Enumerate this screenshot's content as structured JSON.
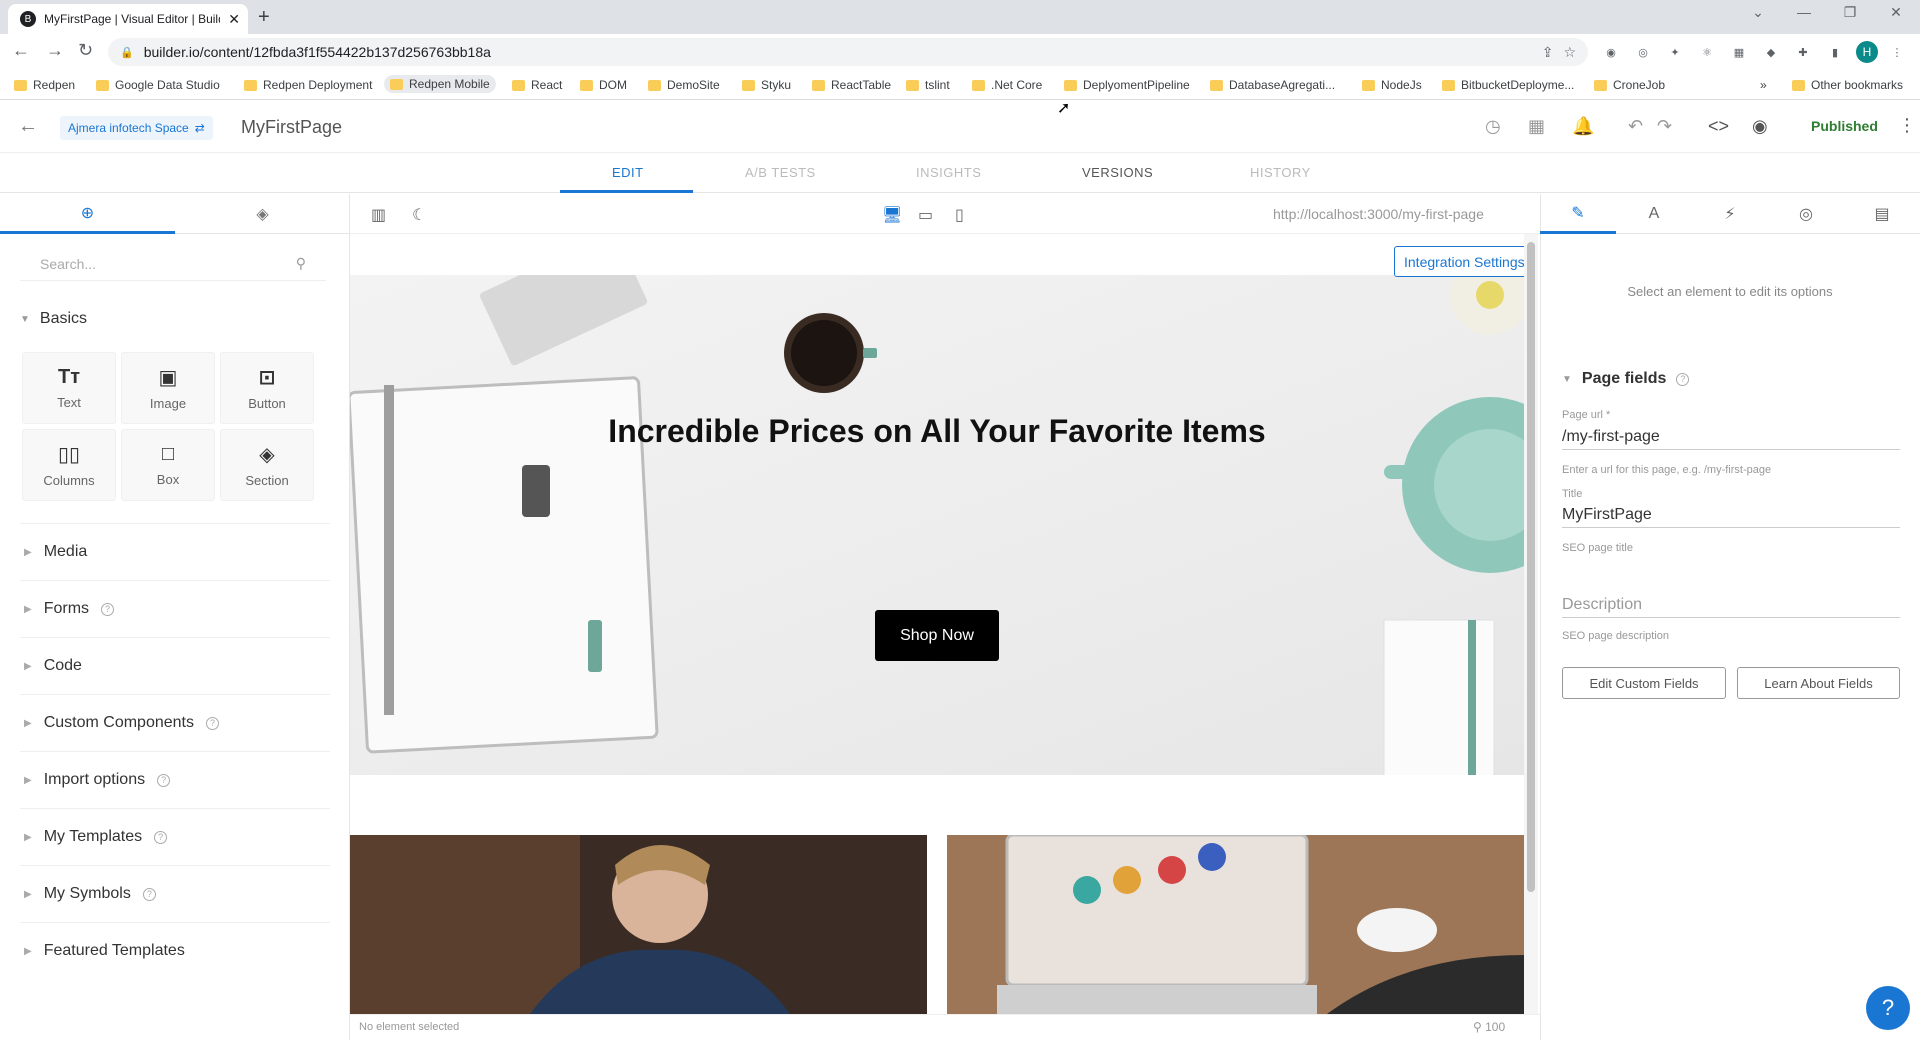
{
  "browser": {
    "tab_title": "MyFirstPage | Visual Editor | Builder.io",
    "url": "builder.io/content/12fbda3f1f554422b137d256763bb18a",
    "profile_initial": "H",
    "bookmarks": [
      "Redpen",
      "Google Data Studio",
      "Redpen Deployment",
      "Redpen Mobile",
      "React",
      "DOM",
      "DemoSite",
      "Styku",
      "ReactTable",
      "tslint",
      ".Net Core",
      "DeplyomentPipeline",
      "DatabaseAgregati...",
      "NodeJs",
      "BitbucketDeployme...",
      "CroneJob"
    ],
    "bookmarks_more": "»",
    "other_bookmarks": "Other bookmarks"
  },
  "header": {
    "space": "Ajmera infotech Space",
    "page_name": "MyFirstPage",
    "status": "Published"
  },
  "tabs": {
    "edit": "EDIT",
    "ab_tests": "A/B TESTS",
    "insights": "INSIGHTS",
    "versions": "VERSIONS",
    "history": "HISTORY"
  },
  "left_panel": {
    "search_placeholder": "Search...",
    "basics_title": "Basics",
    "blocks": [
      {
        "label": "Text",
        "icon": "text-icon",
        "glyph": "Tт"
      },
      {
        "label": "Image",
        "icon": "image-icon",
        "glyph": "▣"
      },
      {
        "label": "Button",
        "icon": "button-icon",
        "glyph": "⊡"
      },
      {
        "label": "Columns",
        "icon": "columns-icon",
        "glyph": "▯▯"
      },
      {
        "label": "Box",
        "icon": "box-icon",
        "glyph": "□"
      },
      {
        "label": "Section",
        "icon": "section-icon",
        "glyph": "◈"
      }
    ],
    "sections": [
      {
        "label": "Media",
        "help": false
      },
      {
        "label": "Forms",
        "help": true
      },
      {
        "label": "Code",
        "help": false
      },
      {
        "label": "Custom Components",
        "help": true
      },
      {
        "label": "Import options",
        "help": true
      },
      {
        "label": "My Templates",
        "help": true
      },
      {
        "label": "My Symbols",
        "help": true
      },
      {
        "label": "Featured Templates",
        "help": false
      }
    ]
  },
  "canvas": {
    "preview_url": "http://localhost:3000/my-first-page",
    "integration_settings": "Integration Settings",
    "hero_title": "Incredible Prices on All Your Favorite Items",
    "cta": "Shop Now",
    "status": "No element selected",
    "zoom": "100"
  },
  "right_panel": {
    "hint": "Select an element to edit its options",
    "page_fields_title": "Page fields",
    "page_url_label": "Page url *",
    "page_url_value": "/my-first-page",
    "page_url_help": "Enter a url for this page, e.g. /my-first-page",
    "title_label": "Title",
    "title_value": "MyFirstPage",
    "title_help": "SEO page title",
    "description_placeholder": "Description",
    "description_help": "SEO page description",
    "edit_custom_fields": "Edit Custom Fields",
    "learn_about_fields": "Learn About Fields"
  },
  "colors": {
    "accent": "#1976d2",
    "published": "#2e7d32",
    "cta_bg": "#000000"
  }
}
